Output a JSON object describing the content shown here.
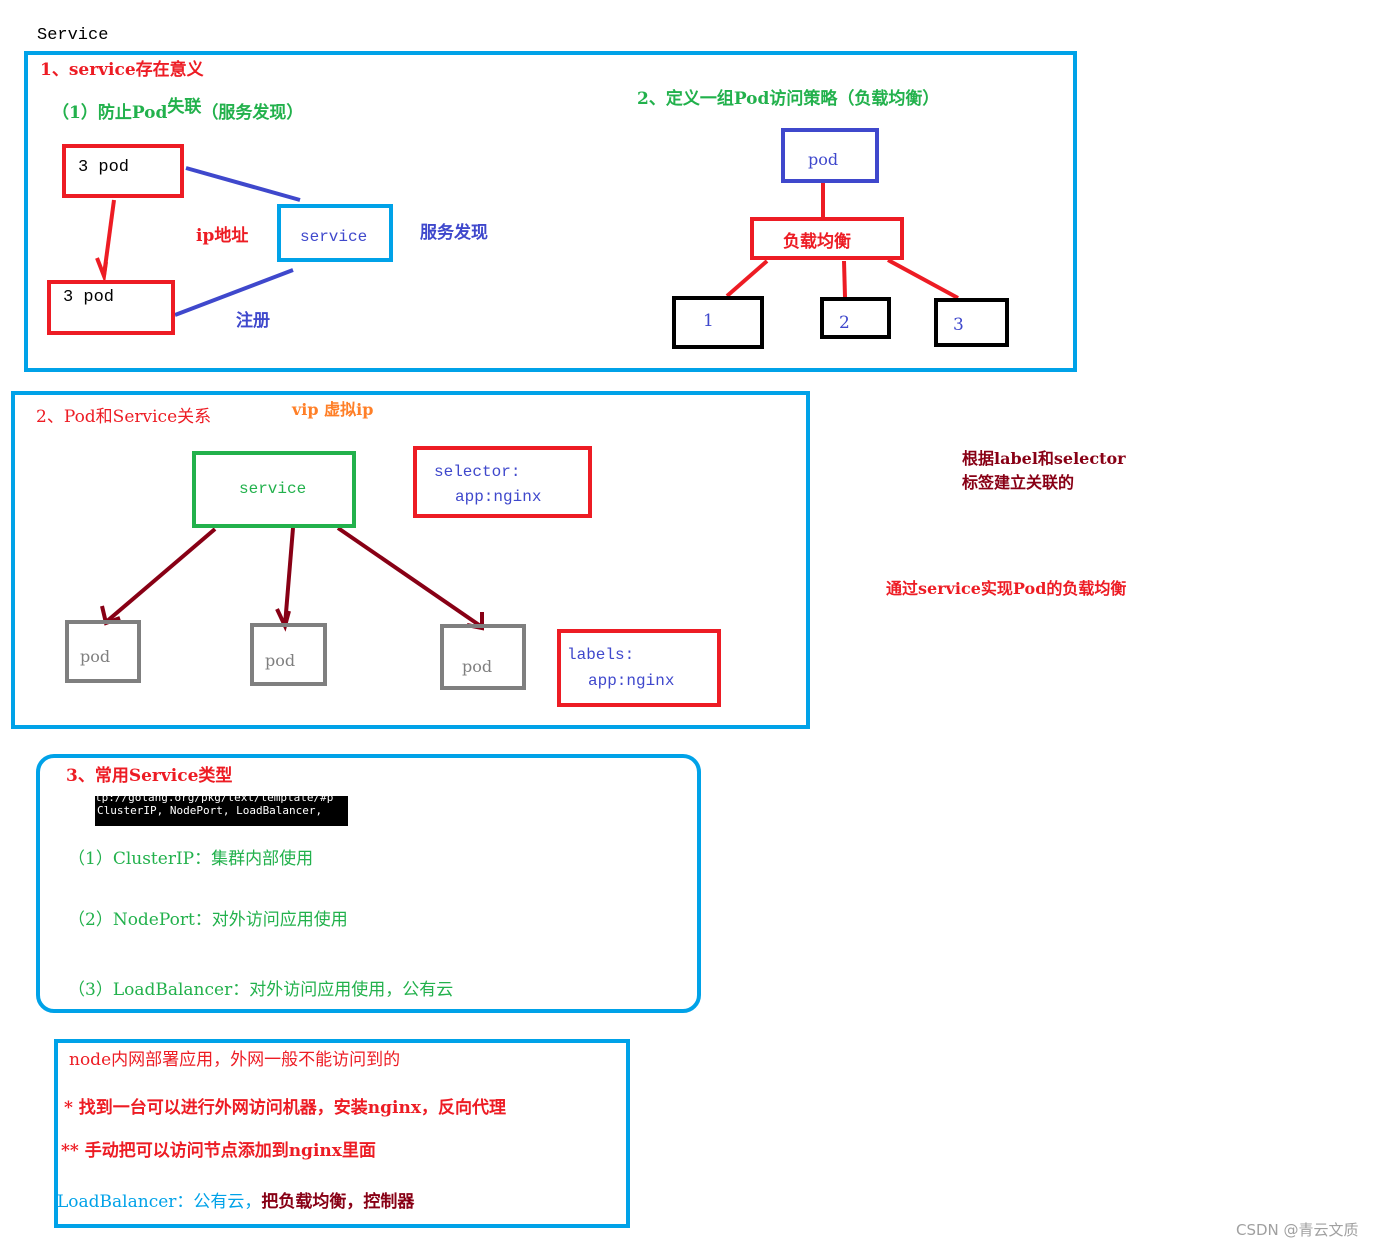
{
  "page_title": "Service",
  "section1": {
    "title": "1、service存在意义",
    "subtitle_prefix": "（1）防止Pod",
    "subtitle_overlay": "失联",
    "subtitle_suffix": "（服务发现）",
    "pod_top": "3  pod",
    "pod_bottom": "3  pod",
    "service": "service",
    "ip_label": "ip地址",
    "discovery_label": "服务发现",
    "register_label": "注册"
  },
  "section1b": {
    "title": "2、定义一组Pod访问策略（负载均衡）",
    "pod": "pod",
    "load_balancer": "负载均衡",
    "nodes": [
      "1",
      "2",
      "3"
    ]
  },
  "section2": {
    "title": "2、Pod和Service关系",
    "vip_label": "vip 虚拟ip",
    "service": "service",
    "selector_key": "selector:",
    "selector_value": "app:nginx",
    "pods": [
      "pod",
      "pod",
      "pod"
    ],
    "labels_key": "labels:",
    "labels_value": "app:nginx"
  },
  "notes": {
    "association_line1": "根据label和selector",
    "association_line2": "标签建立关联的",
    "load_balance_note": "通过service实现Pod的负载均衡"
  },
  "section3": {
    "title": "3、常用Service类型",
    "terminal_line1": "tp://golang.org/pkg/text/template/#p",
    "terminal_line2": " ClusterIP, NodePort, LoadBalancer,",
    "types": [
      "（1）ClusterIP：集群内部使用",
      "（2）NodePort：对外访问应用使用",
      "（3）LoadBalancer：对外访问应用使用，公有云"
    ]
  },
  "section4": {
    "line1": "node内网部署应用，外网一般不能访问到的",
    "line2": "* 找到一台可以进行外网访问机器，安装nginx，反向代理",
    "line3": "** 手动把可以访问节点添加到nginx里面",
    "line4_prefix": "LoadBalancer：公有云，",
    "line4_suffix": "把负载均衡，控制器"
  },
  "watermark": "CSDN @青云文质",
  "colors": {
    "frame_blue": "#00a2e8",
    "red": "#ed1c24",
    "green": "#22b14c",
    "indigo": "#3f48cc",
    "maroon": "#880015",
    "orange": "#ff7f27",
    "grey": "#7f7f7f",
    "black": "#000000"
  }
}
